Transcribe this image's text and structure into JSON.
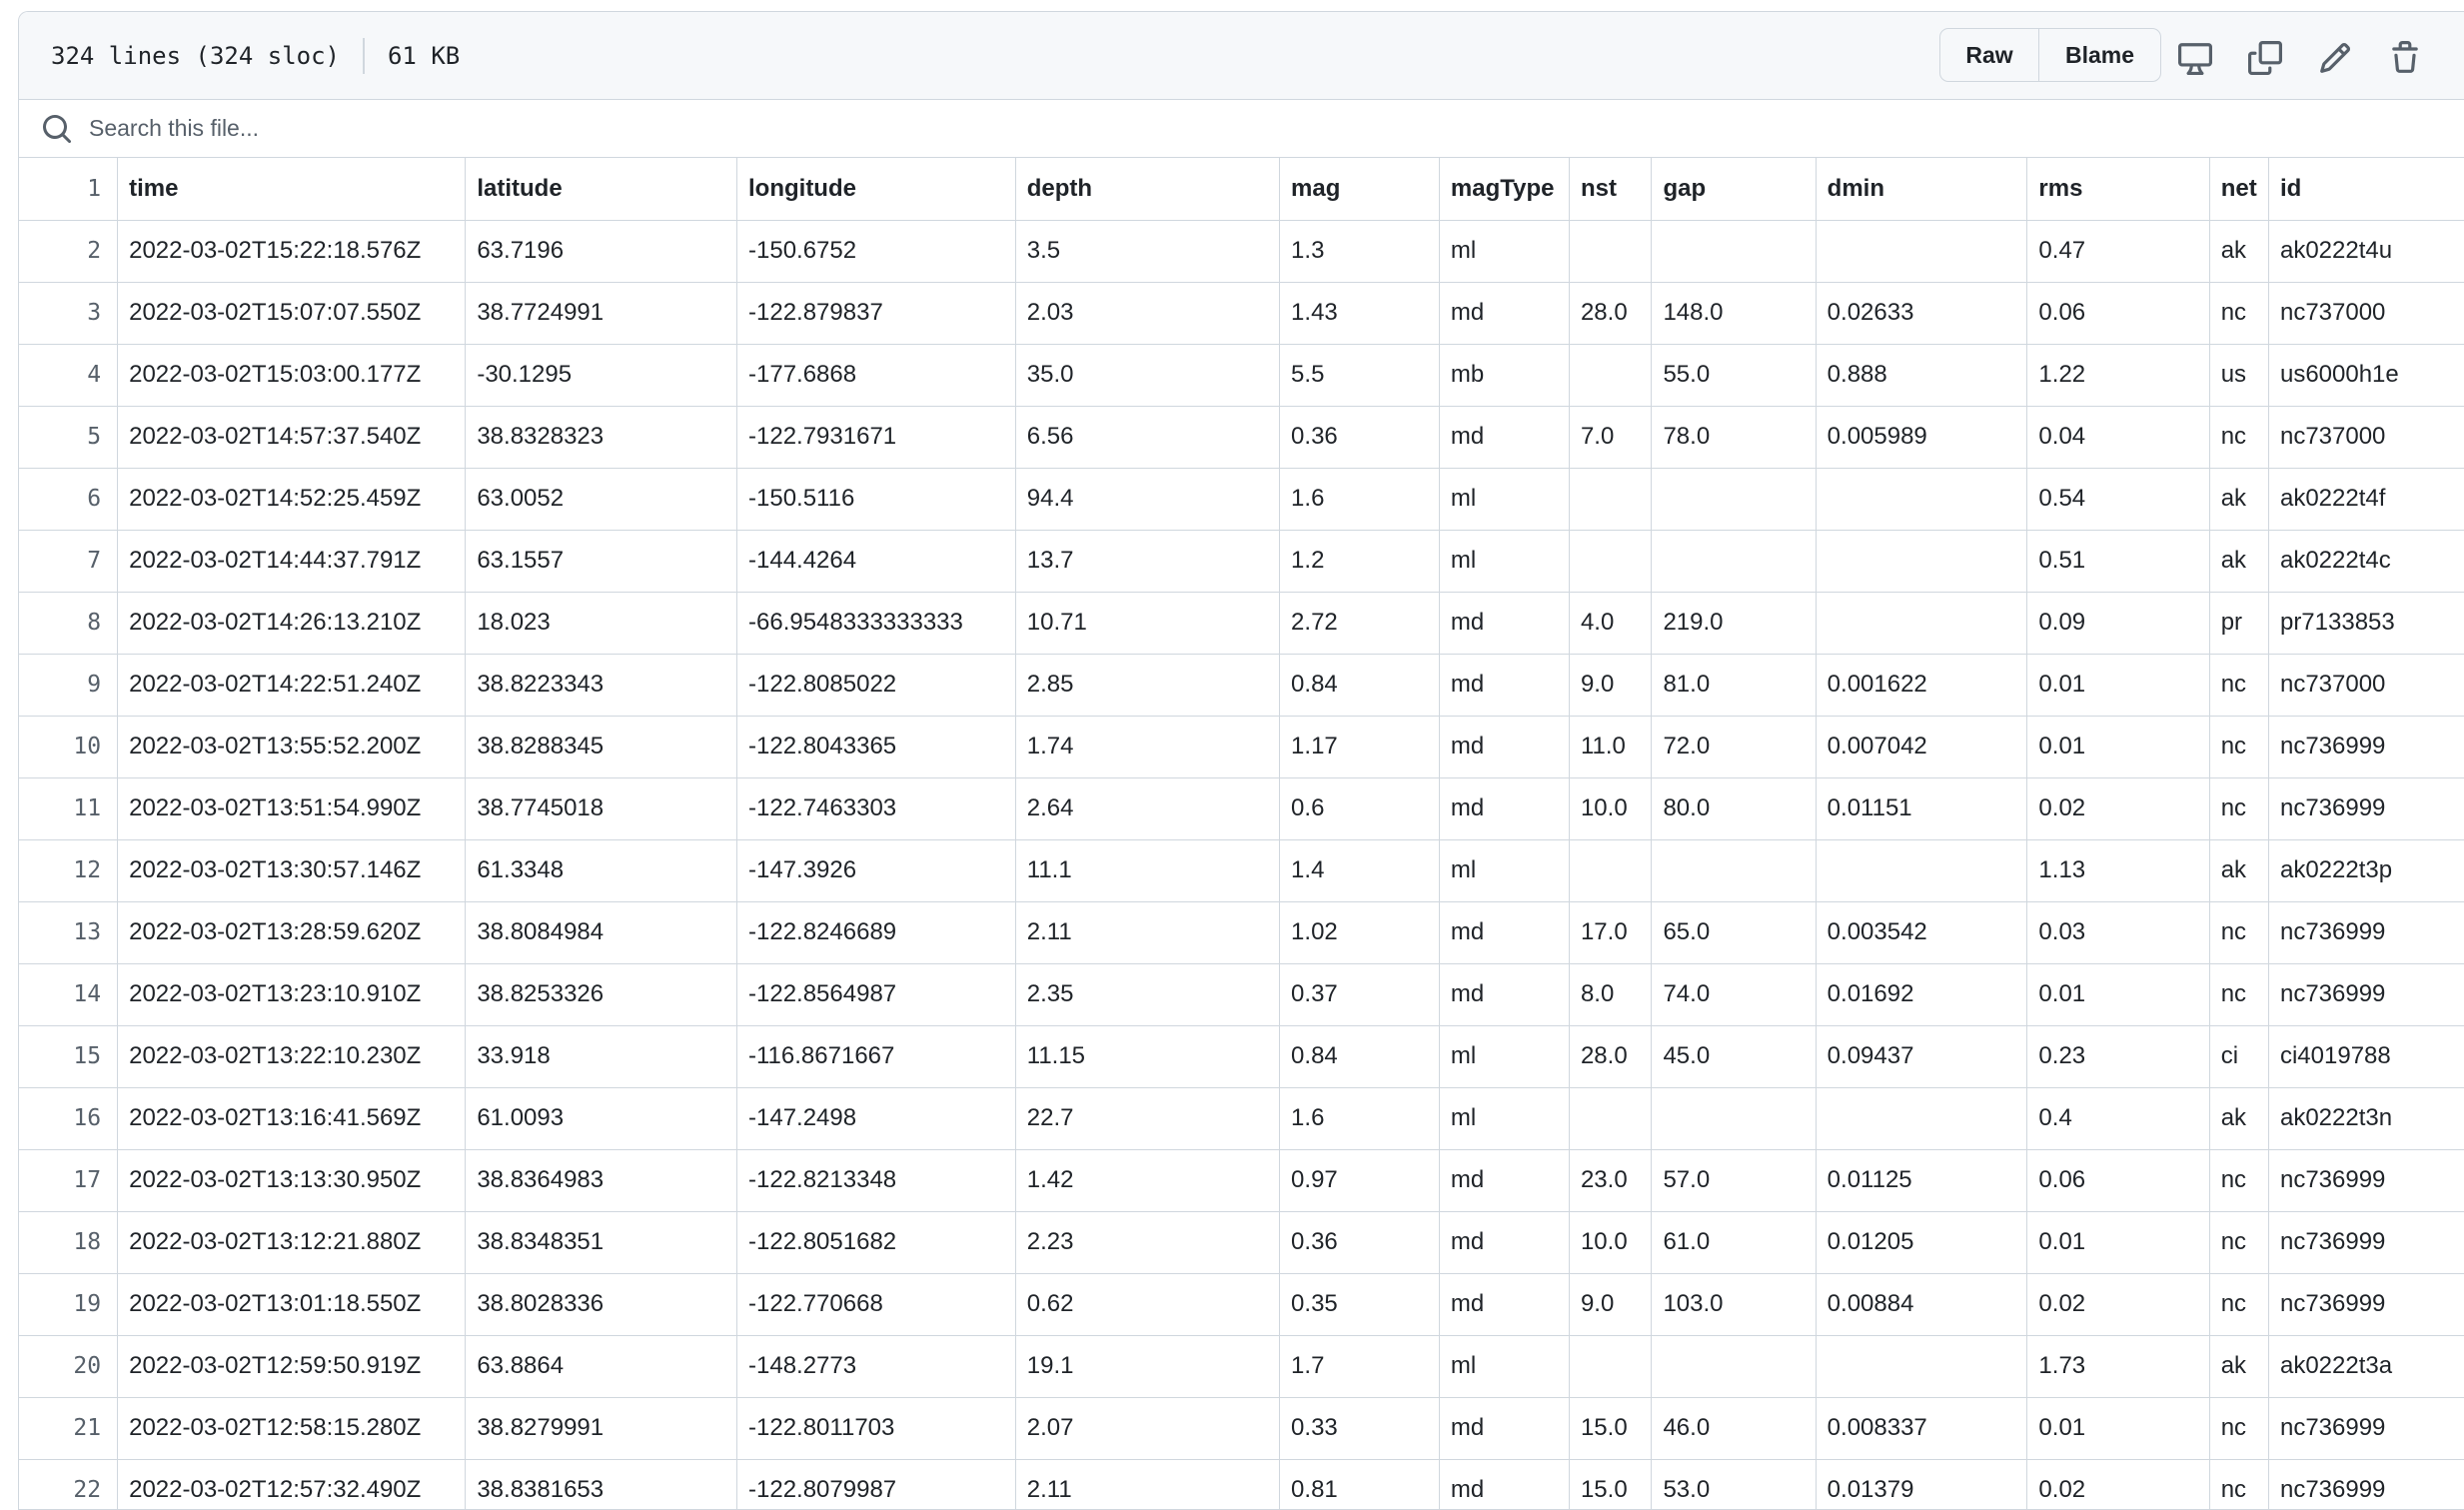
{
  "file_info": {
    "lines": "324 lines (324 sloc)",
    "size": "61 KB"
  },
  "toolbar": {
    "raw_label": "Raw",
    "blame_label": "Blame"
  },
  "search": {
    "placeholder": "Search this file..."
  },
  "table": {
    "headers": [
      "time",
      "latitude",
      "longitude",
      "depth",
      "mag",
      "magType",
      "nst",
      "gap",
      "dmin",
      "rms",
      "net",
      "id"
    ],
    "header_line": "1",
    "rows": [
      {
        "ln": "2",
        "cells": [
          "2022-03-02T15:22:18.576Z",
          "63.7196",
          "-150.6752",
          "3.5",
          "1.3",
          "ml",
          "",
          "",
          "",
          "0.47",
          "ak",
          "ak0222t4u"
        ]
      },
      {
        "ln": "3",
        "cells": [
          "2022-03-02T15:07:07.550Z",
          "38.7724991",
          "-122.879837",
          "2.03",
          "1.43",
          "md",
          "28.0",
          "148.0",
          "0.02633",
          "0.06",
          "nc",
          "nc737000"
        ]
      },
      {
        "ln": "4",
        "cells": [
          "2022-03-02T15:03:00.177Z",
          "-30.1295",
          "-177.6868",
          "35.0",
          "5.5",
          "mb",
          "",
          "55.0",
          "0.888",
          "1.22",
          "us",
          "us6000h1e"
        ]
      },
      {
        "ln": "5",
        "cells": [
          "2022-03-02T14:57:37.540Z",
          "38.8328323",
          "-122.7931671",
          "6.56",
          "0.36",
          "md",
          "7.0",
          "78.0",
          "0.005989",
          "0.04",
          "nc",
          "nc737000"
        ]
      },
      {
        "ln": "6",
        "cells": [
          "2022-03-02T14:52:25.459Z",
          "63.0052",
          "-150.5116",
          "94.4",
          "1.6",
          "ml",
          "",
          "",
          "",
          "0.54",
          "ak",
          "ak0222t4f"
        ]
      },
      {
        "ln": "7",
        "cells": [
          "2022-03-02T14:44:37.791Z",
          "63.1557",
          "-144.4264",
          "13.7",
          "1.2",
          "ml",
          "",
          "",
          "",
          "0.51",
          "ak",
          "ak0222t4c"
        ]
      },
      {
        "ln": "8",
        "cells": [
          "2022-03-02T14:26:13.210Z",
          "18.023",
          "-66.9548333333333",
          "10.71",
          "2.72",
          "md",
          "4.0",
          "219.0",
          "",
          "0.09",
          "pr",
          "pr7133853"
        ]
      },
      {
        "ln": "9",
        "cells": [
          "2022-03-02T14:22:51.240Z",
          "38.8223343",
          "-122.8085022",
          "2.85",
          "0.84",
          "md",
          "9.0",
          "81.0",
          "0.001622",
          "0.01",
          "nc",
          "nc737000"
        ]
      },
      {
        "ln": "10",
        "cells": [
          "2022-03-02T13:55:52.200Z",
          "38.8288345",
          "-122.8043365",
          "1.74",
          "1.17",
          "md",
          "11.0",
          "72.0",
          "0.007042",
          "0.01",
          "nc",
          "nc736999"
        ]
      },
      {
        "ln": "11",
        "cells": [
          "2022-03-02T13:51:54.990Z",
          "38.7745018",
          "-122.7463303",
          "2.64",
          "0.6",
          "md",
          "10.0",
          "80.0",
          "0.01151",
          "0.02",
          "nc",
          "nc736999"
        ]
      },
      {
        "ln": "12",
        "cells": [
          "2022-03-02T13:30:57.146Z",
          "61.3348",
          "-147.3926",
          "11.1",
          "1.4",
          "ml",
          "",
          "",
          "",
          "1.13",
          "ak",
          "ak0222t3p"
        ]
      },
      {
        "ln": "13",
        "cells": [
          "2022-03-02T13:28:59.620Z",
          "38.8084984",
          "-122.8246689",
          "2.11",
          "1.02",
          "md",
          "17.0",
          "65.0",
          "0.003542",
          "0.03",
          "nc",
          "nc736999"
        ]
      },
      {
        "ln": "14",
        "cells": [
          "2022-03-02T13:23:10.910Z",
          "38.8253326",
          "-122.8564987",
          "2.35",
          "0.37",
          "md",
          "8.0",
          "74.0",
          "0.01692",
          "0.01",
          "nc",
          "nc736999"
        ]
      },
      {
        "ln": "15",
        "cells": [
          "2022-03-02T13:22:10.230Z",
          "33.918",
          "-116.8671667",
          "11.15",
          "0.84",
          "ml",
          "28.0",
          "45.0",
          "0.09437",
          "0.23",
          "ci",
          "ci4019788"
        ]
      },
      {
        "ln": "16",
        "cells": [
          "2022-03-02T13:16:41.569Z",
          "61.0093",
          "-147.2498",
          "22.7",
          "1.6",
          "ml",
          "",
          "",
          "",
          "0.4",
          "ak",
          "ak0222t3n"
        ]
      },
      {
        "ln": "17",
        "cells": [
          "2022-03-02T13:13:30.950Z",
          "38.8364983",
          "-122.8213348",
          "1.42",
          "0.97",
          "md",
          "23.0",
          "57.0",
          "0.01125",
          "0.06",
          "nc",
          "nc736999"
        ]
      },
      {
        "ln": "18",
        "cells": [
          "2022-03-02T13:12:21.880Z",
          "38.8348351",
          "-122.8051682",
          "2.23",
          "0.36",
          "md",
          "10.0",
          "61.0",
          "0.01205",
          "0.01",
          "nc",
          "nc736999"
        ]
      },
      {
        "ln": "19",
        "cells": [
          "2022-03-02T13:01:18.550Z",
          "38.8028336",
          "-122.770668",
          "0.62",
          "0.35",
          "md",
          "9.0",
          "103.0",
          "0.00884",
          "0.02",
          "nc",
          "nc736999"
        ]
      },
      {
        "ln": "20",
        "cells": [
          "2022-03-02T12:59:50.919Z",
          "63.8864",
          "-148.2773",
          "19.1",
          "1.7",
          "ml",
          "",
          "",
          "",
          "1.73",
          "ak",
          "ak0222t3a"
        ]
      },
      {
        "ln": "21",
        "cells": [
          "2022-03-02T12:58:15.280Z",
          "38.8279991",
          "-122.8011703",
          "2.07",
          "0.33",
          "md",
          "15.0",
          "46.0",
          "0.008337",
          "0.01",
          "nc",
          "nc736999"
        ]
      },
      {
        "ln": "22",
        "cells": [
          "2022-03-02T12:57:32.490Z",
          "38.8381653",
          "-122.8079987",
          "2.11",
          "0.81",
          "md",
          "15.0",
          "53.0",
          "0.01379",
          "0.02",
          "nc",
          "nc736999"
        ]
      }
    ]
  }
}
